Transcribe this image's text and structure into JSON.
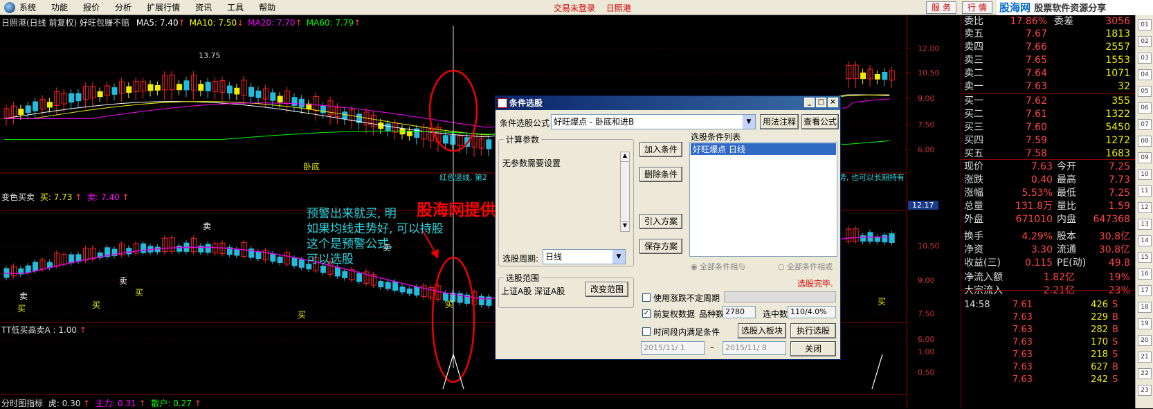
{
  "menu": {
    "items": [
      "系统",
      "功能",
      "报价",
      "分析",
      "扩展行情",
      "资讯",
      "工具",
      "帮助"
    ],
    "status": "交易未登录",
    "stock": "日照港",
    "btn1": "服 务",
    "btn2": "行 情",
    "logo1": "股海网",
    "logo2": "股票软件资源分享"
  },
  "chart": {
    "title": "日照港(日线 前复权) 好旺包赚不赔",
    "ma": [
      {
        "label": "MA5: 7.40",
        "arrow": "↑",
        "color": "#ffffff"
      },
      {
        "label": "MA10: 7.50",
        "arrow": "↓",
        "color": "#ffff00"
      },
      {
        "label": "MA20: 7.70",
        "arrow": "↑",
        "color": "#ff00ff"
      },
      {
        "label": "MA60: 7.79",
        "arrow": "↑",
        "color": "#00ff00"
      }
    ],
    "y_top": [
      "12.00",
      "10.50",
      "9.00",
      "7.50",
      "6.00"
    ],
    "y_mid": [
      "12.00",
      "10.50",
      "9.00",
      "7.50",
      "6.00"
    ],
    "y_bot": [
      "1.00",
      "0.50"
    ],
    "current_price": "12.17",
    "peak_label": "13.75",
    "bottom_label": "卧底",
    "note_left": "红色竖线, 第2",
    "note_right": "势, 也可以长期持有",
    "panel2_title": "变色买卖",
    "panel2_buy": "买: 7.73",
    "panel2_sell": "卖: 7.40",
    "panel3_title": "TT低买高卖A : 1.00",
    "panel4_title": "分时图指标",
    "panel4_a": "虎: 0.30",
    "panel4_b": "主力: 0.31",
    "panel4_c": "散户: 0.27",
    "sell_mark": "卖",
    "buy_mark": "买",
    "annotation": [
      "预警出来就买, 明",
      "如果均线走势好, 可以持股",
      "这个是预警公式,",
      "可以选股"
    ],
    "watermark": "股海网提供 Www.Guhai.Com.CN"
  },
  "dialog": {
    "title": "条件选股",
    "formula_label": "条件选股公式",
    "formula_value": "好旺爆点          - 卧底和进B",
    "usage_btn": "用法注释",
    "view_btn": "查看公式",
    "params_group": "计算参数",
    "params_text": "无参数需要设置",
    "cond_list_label": "选股条件列表",
    "cond_list_item": "好旺爆点  日线",
    "add_btn": "加入条件",
    "del_btn": "删除条件",
    "import_btn": "引入方案",
    "save_btn": "保存方案",
    "period_label": "选股周期:",
    "period_value": "日线",
    "radio_and": "全部条件相与",
    "radio_or": "全部条件相或",
    "range_group": "选股范围",
    "range_text": "上证A股  深证A股",
    "change_range_btn": "改变范围",
    "done_text": "选股完毕.",
    "chk1": "使用涨跌不定周期",
    "chk2": "前复权数据",
    "count_label": "品种数",
    "count_value": "2780",
    "selected_label": "选中数",
    "selected_value": "110/4.0%",
    "chk3": "时间段内满足条件",
    "to_block_btn": "选股入板块",
    "run_btn": "执行选股",
    "date1": "2015/11/ 1",
    "date2": "2015/11/ 8",
    "close_btn": "关闭"
  },
  "quote": {
    "top": {
      "l": "委比",
      "v": "17.86%",
      "l2": "委差",
      "v2": "3056"
    },
    "sell": [
      {
        "l": "卖五",
        "p": "7.67",
        "v": "1813"
      },
      {
        "l": "卖四",
        "p": "7.66",
        "v": "2557"
      },
      {
        "l": "卖三",
        "p": "7.65",
        "v": "1553"
      },
      {
        "l": "卖二",
        "p": "7.64",
        "v": "1071"
      },
      {
        "l": "卖一",
        "p": "7.63",
        "v": "32"
      }
    ],
    "buy": [
      {
        "l": "买一",
        "p": "7.62",
        "v": "355"
      },
      {
        "l": "买二",
        "p": "7.61",
        "v": "1322"
      },
      {
        "l": "买三",
        "p": "7.60",
        "v": "5450"
      },
      {
        "l": "买四",
        "p": "7.59",
        "v": "1272"
      },
      {
        "l": "买五",
        "p": "7.58",
        "v": "1683"
      }
    ],
    "stats": [
      {
        "a": "现价",
        "b": "7.63",
        "c": "今开",
        "d": "7.25"
      },
      {
        "a": "涨跌",
        "b": "0.40",
        "c": "最高",
        "d": "7.73"
      },
      {
        "a": "涨幅",
        "b": "5.53%",
        "c": "最低",
        "d": "7.25"
      },
      {
        "a": "总量",
        "b": "131.8万",
        "c": "量比",
        "d": "1.59"
      },
      {
        "a": "外盘",
        "b": "671010",
        "c": "内盘",
        "d": "647368"
      },
      {
        "a": "换手",
        "b": "4.29%",
        "c": "股本",
        "d": "30.8亿"
      },
      {
        "a": "净资",
        "b": "3.30",
        "c": "流通",
        "d": "30.8亿"
      },
      {
        "a": "收益(三)",
        "b": "0.115",
        "c": "PE(动)",
        "d": "49.8"
      }
    ],
    "flow": [
      {
        "a": "净流入额",
        "b": "1.82亿",
        "c": "19%"
      },
      {
        "a": "大宗流入",
        "b": "2.21亿",
        "c": "23%"
      }
    ],
    "ticks": [
      {
        "t": "14:58",
        "p": "7.61",
        "v": "426",
        "b": "S"
      },
      {
        "t": "",
        "p": "7.63",
        "v": "229",
        "b": "B"
      },
      {
        "t": "",
        "p": "7.63",
        "v": "282",
        "b": "B"
      },
      {
        "t": "",
        "p": "7.63",
        "v": "170",
        "b": "S"
      },
      {
        "t": "",
        "p": "7.63",
        "v": "218",
        "b": "S"
      },
      {
        "t": "",
        "p": "7.63",
        "v": "627",
        "b": "B"
      },
      {
        "t": "",
        "p": "7.63",
        "v": "242",
        "b": "S"
      }
    ]
  },
  "toolbar": [
    "01",
    "02",
    "03",
    "04",
    "05",
    "06",
    "07",
    "08",
    "09",
    "10",
    "11",
    "12",
    "13",
    "14",
    "15",
    "16",
    "17",
    "18",
    "19",
    "20",
    "21",
    "22",
    "23"
  ]
}
